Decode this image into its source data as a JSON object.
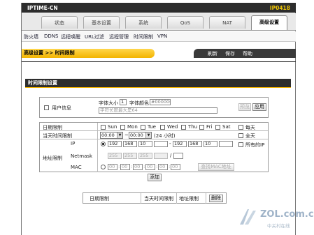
{
  "brand": "IPTIME-CN",
  "model": "IP0418",
  "tabs": [
    {
      "label": "状态"
    },
    {
      "label": "基本设置"
    },
    {
      "label": "系统"
    },
    {
      "label": "QoS"
    },
    {
      "label": "NAT"
    },
    {
      "label": "高级设置",
      "active": true
    }
  ],
  "subnav": [
    "防火墙",
    "DDNS",
    "远程唤醒",
    "URL过滤",
    "远程管理",
    "时间限制",
    "VPN"
  ],
  "breadcrumb": "高级设置 >> 时间限制",
  "actions": [
    "刷新",
    "保存",
    "帮助"
  ],
  "section_title": "时间限制设置",
  "user_info": {
    "label": "用户信息",
    "font_size_label": "字体大小",
    "font_size_value": "1",
    "font_color_label": "字体颜色",
    "font_color_value": "#000000",
    "text_placeholder": "字符长度最大是64",
    "preview_label": "预览",
    "apply_label": "应用"
  },
  "date_limit": {
    "label": "日期限制",
    "days": [
      "Sun",
      "Mon",
      "Tue",
      "Wed",
      "Thu",
      "Fri",
      "Sat"
    ],
    "everyday": "每天"
  },
  "time_limit": {
    "label": "当天时间限制",
    "start": "00:00",
    "end": "00:00",
    "separator": "~",
    "note": "(24 小时)",
    "allday": "全天"
  },
  "address_limit": {
    "label": "地址限制",
    "ip_label": "IP",
    "ip_start": [
      "192",
      "168",
      "10",
      ""
    ],
    "ip_end": [
      "192",
      "168",
      "10",
      ""
    ],
    "ip_dash": "-",
    "all_ip": "所有的IP",
    "netmask_label": "Netmask",
    "netmask": [
      "255",
      "255",
      "255",
      ""
    ],
    "netmask_slash": "/",
    "mac_label": "MAC",
    "mac": [
      "00",
      "00",
      "00",
      "00",
      "00",
      "00"
    ],
    "mac_sep": ":",
    "find_mac": "查找MAC地址"
  },
  "add_label": "添加",
  "result_table": {
    "headers": [
      "日期限制",
      "当天时间限制",
      "地址限制"
    ],
    "delete_label": "删除"
  },
  "watermark": {
    "site": "ZOL.com.cn",
    "sub": "中关村在线"
  }
}
